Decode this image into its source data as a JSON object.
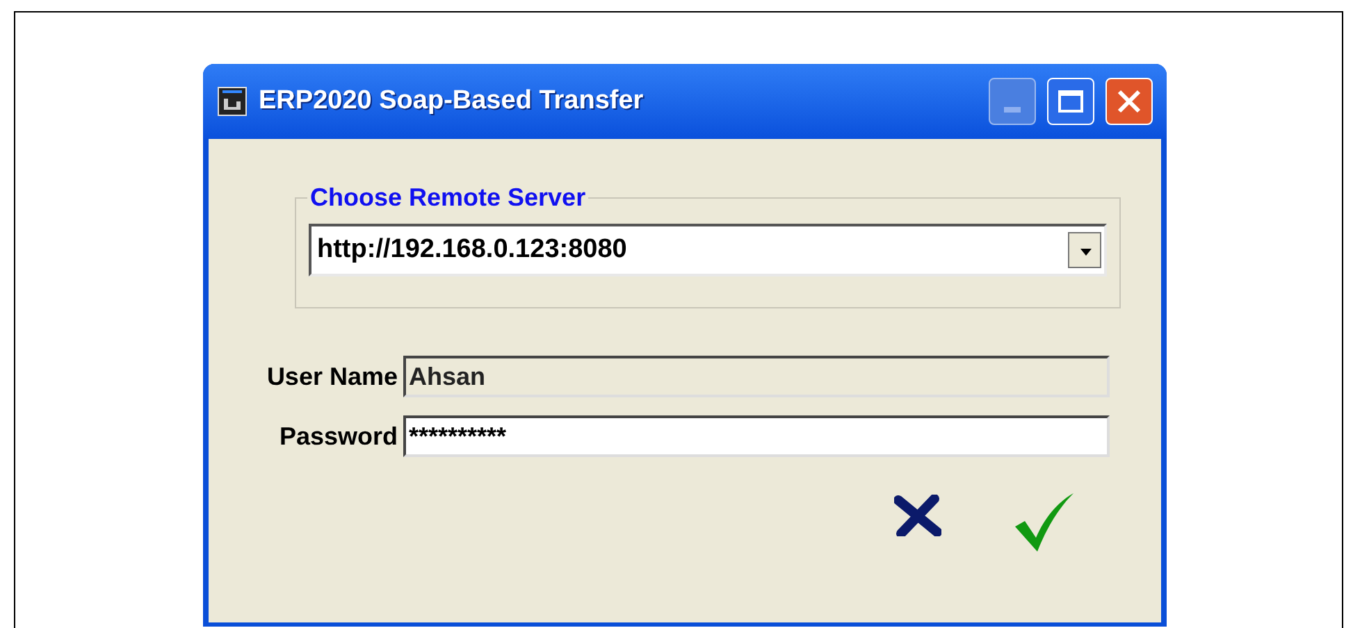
{
  "window": {
    "title": "ERP2020 Soap-Based Transfer"
  },
  "server_group": {
    "legend": "Choose Remote Server",
    "value": "http://192.168.0.123:8080"
  },
  "fields": [
    {
      "label": "User Name",
      "value": "Ahsan",
      "disabled": true
    },
    {
      "label": "Password",
      "value": "**********",
      "disabled": false
    }
  ]
}
